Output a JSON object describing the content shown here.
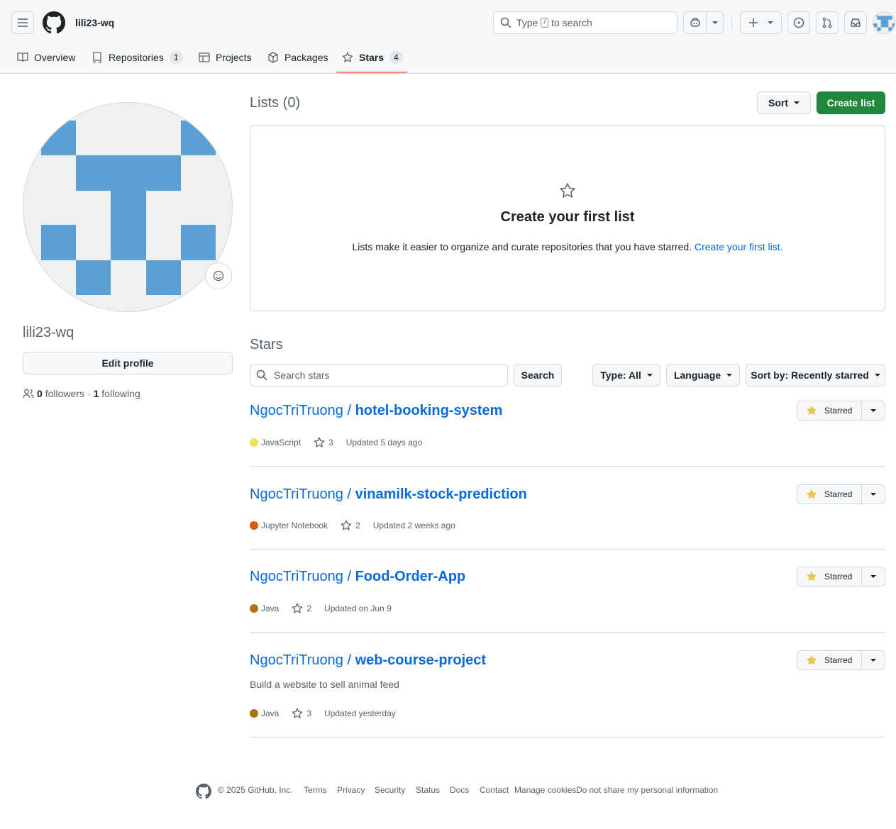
{
  "header": {
    "username": "lili23-wq",
    "search_prefix": "Type",
    "search_key": "/",
    "search_suffix": "to search"
  },
  "tabs": [
    {
      "label": "Overview"
    },
    {
      "label": "Repositories",
      "count": "1"
    },
    {
      "label": "Projects"
    },
    {
      "label": "Packages"
    },
    {
      "label": "Stars",
      "count": "4"
    }
  ],
  "profile": {
    "username": "lili23-wq",
    "edit_profile": "Edit profile",
    "followers_count": "0",
    "followers_label": "followers",
    "separator": "·",
    "following_count": "1",
    "following_label": "following"
  },
  "lists": {
    "heading": "Lists (0)",
    "sort_label": "Sort",
    "create_label": "Create list",
    "empty_title": "Create your first list",
    "empty_text": "Lists make it easier to organize and curate repositories that you have starred.",
    "empty_link": "Create your first list."
  },
  "stars": {
    "heading": "Stars",
    "search_placeholder": "Search stars",
    "search_button": "Search",
    "type_filter": "Type: All",
    "language_filter": "Language",
    "sort_filter": "Sort by: Recently starred",
    "starred_label": "Starred",
    "repos": [
      {
        "owner": "NgocTriTruong",
        "sep": "/",
        "name": "hotel-booking-system",
        "description": "",
        "language": "JavaScript",
        "lang_color": "#f1e05a",
        "stars": "3",
        "updated": "Updated 5 days ago"
      },
      {
        "owner": "NgocTriTruong",
        "sep": "/",
        "name": "vinamilk-stock-prediction",
        "description": "",
        "language": "Jupyter Notebook",
        "lang_color": "#DA5B0B",
        "stars": "2",
        "updated": "Updated 2 weeks ago"
      },
      {
        "owner": "NgocTriTruong",
        "sep": "/",
        "name": "Food-Order-App",
        "description": "",
        "language": "Java",
        "lang_color": "#b07219",
        "stars": "2",
        "updated": "Updated on Jun 9"
      },
      {
        "owner": "NgocTriTruong",
        "sep": "/",
        "name": "web-course-project",
        "description": "Build a website to sell animal feed",
        "language": "Java",
        "lang_color": "#b07219",
        "stars": "3",
        "updated": "Updated yesterday"
      }
    ]
  },
  "footer": {
    "copyright": "© 2025 GitHub, Inc.",
    "links": [
      "Terms",
      "Privacy",
      "Security",
      "Status",
      "Docs",
      "Contact",
      "Manage cookies",
      "Do not share my personal information"
    ]
  },
  "colors": {
    "accent": "#0969da",
    "primary_button": "#1f883d",
    "active_tab_underline": "#fd8c73",
    "avatar_blue": "#5aa0d4",
    "star_yellow": "#eac54f"
  },
  "icons": [
    "menu-icon",
    "github-logo-icon",
    "search-icon",
    "copilot-icon",
    "plus-icon",
    "issues-icon",
    "pull-requests-icon",
    "inbox-icon",
    "book-icon",
    "repo-icon",
    "table-icon",
    "package-icon",
    "star-icon",
    "smiley-icon",
    "people-icon"
  ]
}
